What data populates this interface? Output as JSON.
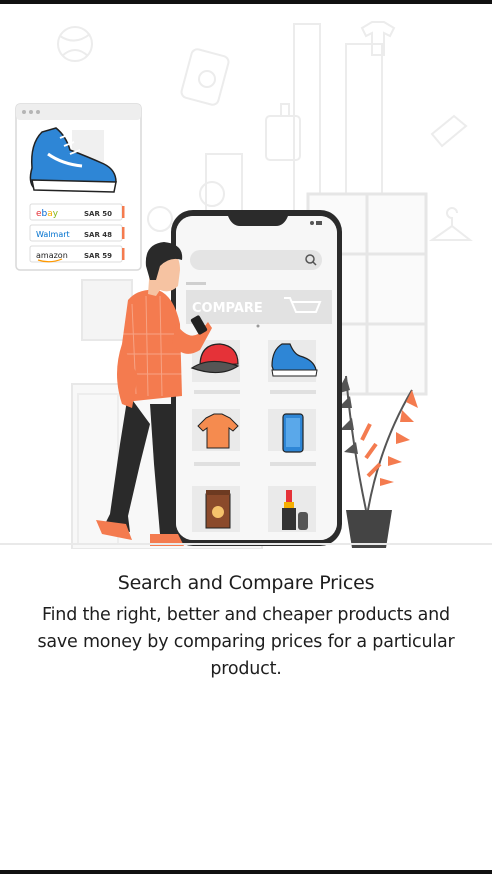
{
  "onboarding": {
    "title": "Search and Compare Prices",
    "description": "Find the right,  better and cheaper products and save money by comparing prices for a particular product."
  },
  "price_card": {
    "rows": [
      {
        "store": "ebay",
        "price": "SAR 50"
      },
      {
        "store": "Walmart",
        "price": "SAR 48"
      },
      {
        "store": "amazon",
        "price": "SAR 59"
      }
    ]
  },
  "phone": {
    "banner_label": "COMPARE"
  },
  "colors": {
    "accent": "#f47b4f",
    "shoe_blue": "#2e86d6",
    "ebay_red": "#e53238",
    "ebay_blue": "#0064d2",
    "ebay_yellow": "#f5af02",
    "ebay_green": "#86b817",
    "walmart_blue": "#0071ce",
    "amazon_orange": "#ff9900"
  }
}
